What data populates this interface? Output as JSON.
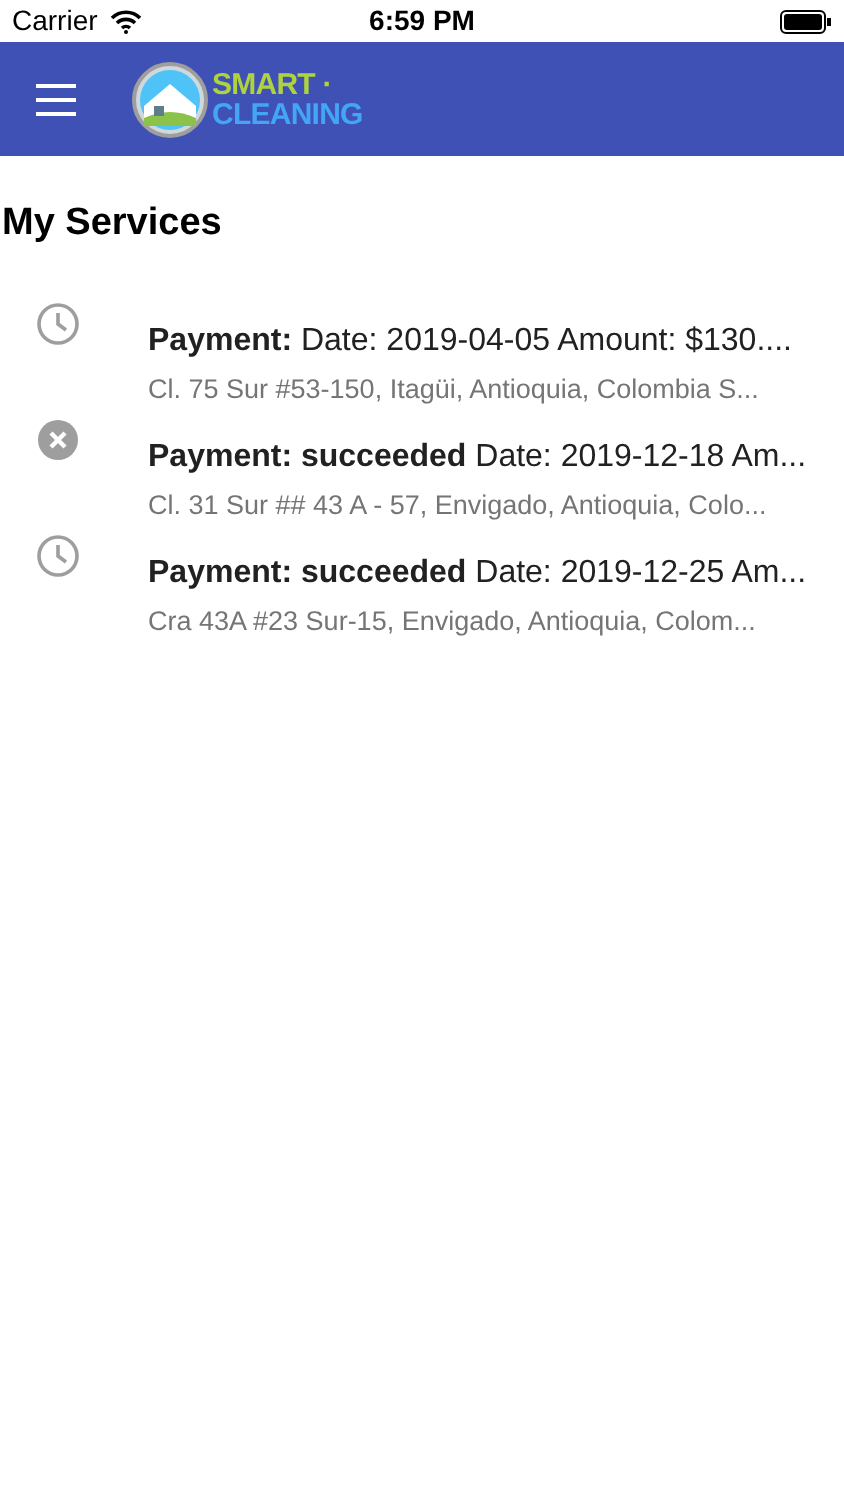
{
  "status_bar": {
    "carrier": "Carrier",
    "time": "6:59 PM"
  },
  "app_bar": {
    "logo_line_1": "SMART ·",
    "logo_line_2": "CLEANING"
  },
  "page_title": "My Services",
  "services": [
    {
      "kind": "pending",
      "title": "**Payment:** Date: 2019-04-05 Amount: $130....",
      "address": "Cl. 75 Sur #53-150, Itagüi, Antioquia, Colombia S..."
    },
    {
      "kind": "cancelled",
      "title": "**Payment: succeeded** Date: 2019-12-18 Am...",
      "address": "Cl. 31 Sur ## 43 A - 57, Envigado, Antioquia, Colo..."
    },
    {
      "kind": "pending",
      "title": "**Payment: succeeded** Date: 2019-12-25 Am...",
      "address": "Cra 43A #23 Sur-15, Envigado, Antioquia, Colom..."
    }
  ]
}
